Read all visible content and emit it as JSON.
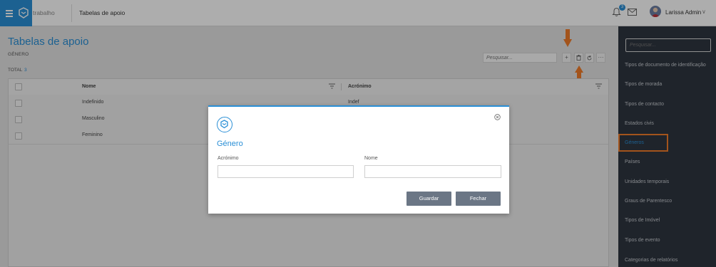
{
  "topbar": {
    "breadcrumb_1": "trabalho",
    "breadcrumb_2": "Tabelas de apoio",
    "notification_count": "3",
    "user_name": "Larissa Admin",
    "user_chevron": "∨"
  },
  "page": {
    "title": "Tabelas de apoio",
    "subtitle": "GÉNERO",
    "total_label": "TOTAL",
    "total_value": "3"
  },
  "toolbar": {
    "search_placeholder": "Pesquisar...",
    "add_label": "+",
    "more_label": "···"
  },
  "table": {
    "columns": [
      "Nome",
      "Acrónimo"
    ],
    "rows": [
      {
        "nome": "Indefinido",
        "acronimo": "Indef"
      },
      {
        "nome": "Masculino",
        "acronimo": ""
      },
      {
        "nome": "Feminino",
        "acronimo": ""
      }
    ]
  },
  "sidebar": {
    "search_placeholder": "Pesquisar...",
    "items": [
      "Tipos de documento de identificação",
      "Tipos de morada",
      "Tipos de contacto",
      "Estados civis",
      "Géneros",
      "Países",
      "Unidades temporais",
      "Graus de Parentesco",
      "Tipos de Imóvel",
      "Tipos de evento",
      "Categorias de relatórios"
    ],
    "active_index": 4,
    "active_color": "#2a8fd6",
    "highlight_color": "#f07c2a"
  },
  "modal": {
    "title": "Género",
    "field_1_label": "Acrónimo",
    "field_1_value": "",
    "field_2_label": "Nome",
    "field_2_value": "",
    "save_label": "Guardar",
    "close_label": "Fechar"
  },
  "colors": {
    "accent": "#2a8fd6",
    "annotation_arrow": "#f07c2a"
  }
}
